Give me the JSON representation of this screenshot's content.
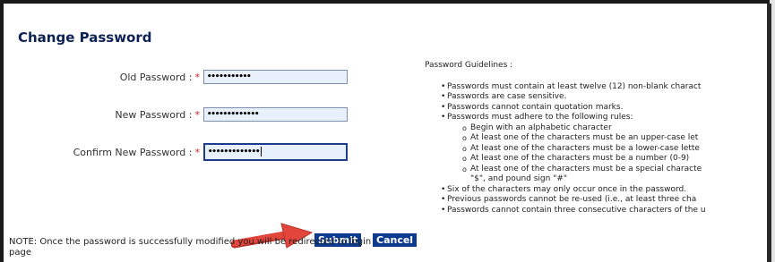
{
  "page": {
    "heading": "Change Password"
  },
  "form": {
    "old_password": {
      "label": "Old Password :",
      "required_mark": "*",
      "value": "•••••••••••"
    },
    "new_password": {
      "label": "New Password :",
      "required_mark": "*",
      "value": "•••••••••••••"
    },
    "confirm_password": {
      "label": "Confirm New Password :",
      "required_mark": "*",
      "value": "•••••••••••••"
    }
  },
  "buttons": {
    "submit": "Submit",
    "cancel": "Cancel"
  },
  "note": "NOTE: Once the password is successfully modified you will be redirected to login page",
  "guidelines": {
    "title": "Password Guidelines :",
    "items": [
      "Passwords must contain at least twelve (12) non-blank charact",
      "Passwords are case sensitive.",
      "Passwords cannot contain quotation marks.",
      "Passwords must adhere to the following rules:"
    ],
    "sub_items": [
      "Begin with an alphabetic character",
      "At least one of the characters must be an upper-case let",
      "At least one of the characters must be a lower-case lette",
      "At least one of the characters must be a number (0-9)",
      "At least one of the characters must be a special characte"
    ],
    "sub_continuation": "\"$\", and pound sign \"#\"",
    "items_after": [
      "Six of the characters may only occur once in the password.",
      "Previous passwords cannot be re-used (i.e., at least three cha",
      "Passwords cannot contain three consecutive characters of the u"
    ]
  },
  "colors": {
    "heading": "#0c2154",
    "button_bg": "#0b3a8f",
    "required": "#d21f1f",
    "input_bg": "#e8f1fb",
    "arrow": "#e2453c"
  },
  "icons": {
    "arrow": "red-pointer-arrow"
  }
}
